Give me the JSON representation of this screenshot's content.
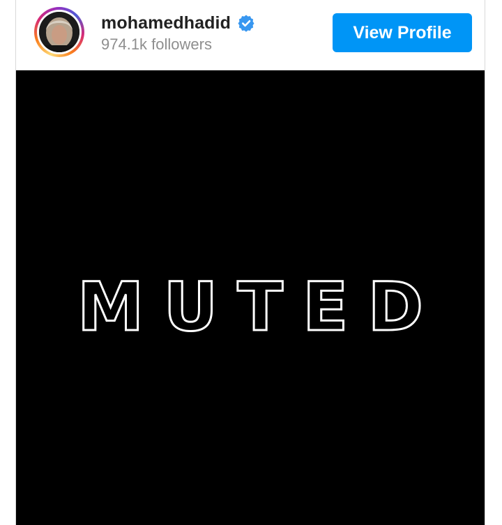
{
  "post_header": {
    "username": "mohamedhadid",
    "verified_icon": "verified-badge-icon",
    "followers": "974.1k followers",
    "view_profile_label": "View Profile",
    "accent_color": "#0095f6"
  },
  "media": {
    "overlay_text": "MUTED",
    "background_color": "#000000"
  }
}
